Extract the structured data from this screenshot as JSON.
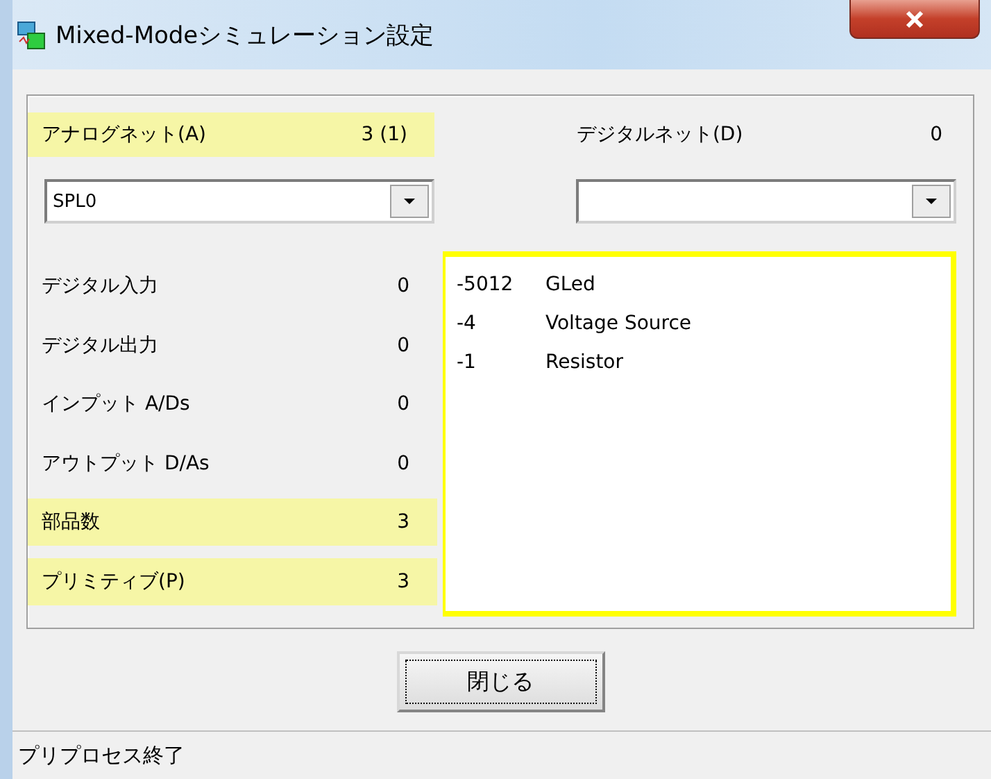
{
  "window": {
    "title": "Mixed-Modeシミュレーション設定"
  },
  "analog_net": {
    "label": "アナログネット(A)",
    "value": "3 (1)",
    "highlighted": true,
    "combo_value": "SPL0"
  },
  "digital_net": {
    "label": "デジタルネット(D)",
    "value": "0",
    "highlighted": false
  },
  "stats": [
    {
      "label": "デジタル入力",
      "value": "0",
      "highlighted": false
    },
    {
      "label": "デジタル出力",
      "value": "0",
      "highlighted": false
    },
    {
      "label": "インプット A/Ds",
      "value": "0",
      "highlighted": false
    },
    {
      "label": "アウトプット D/As",
      "value": "0",
      "highlighted": false
    },
    {
      "label": "部品数",
      "value": "3",
      "highlighted": true
    },
    {
      "label": "プリミティブ(P)",
      "value": "3",
      "highlighted": true
    }
  ],
  "parts_list": {
    "highlighted": true,
    "rows": [
      {
        "id": "-5012",
        "name": "GLed"
      },
      {
        "id": "-4",
        "name": "Voltage Source"
      },
      {
        "id": "-1",
        "name": "Resistor"
      }
    ]
  },
  "buttons": [
    "閉じる"
  ],
  "status_bar": "プリプロセス終了"
}
